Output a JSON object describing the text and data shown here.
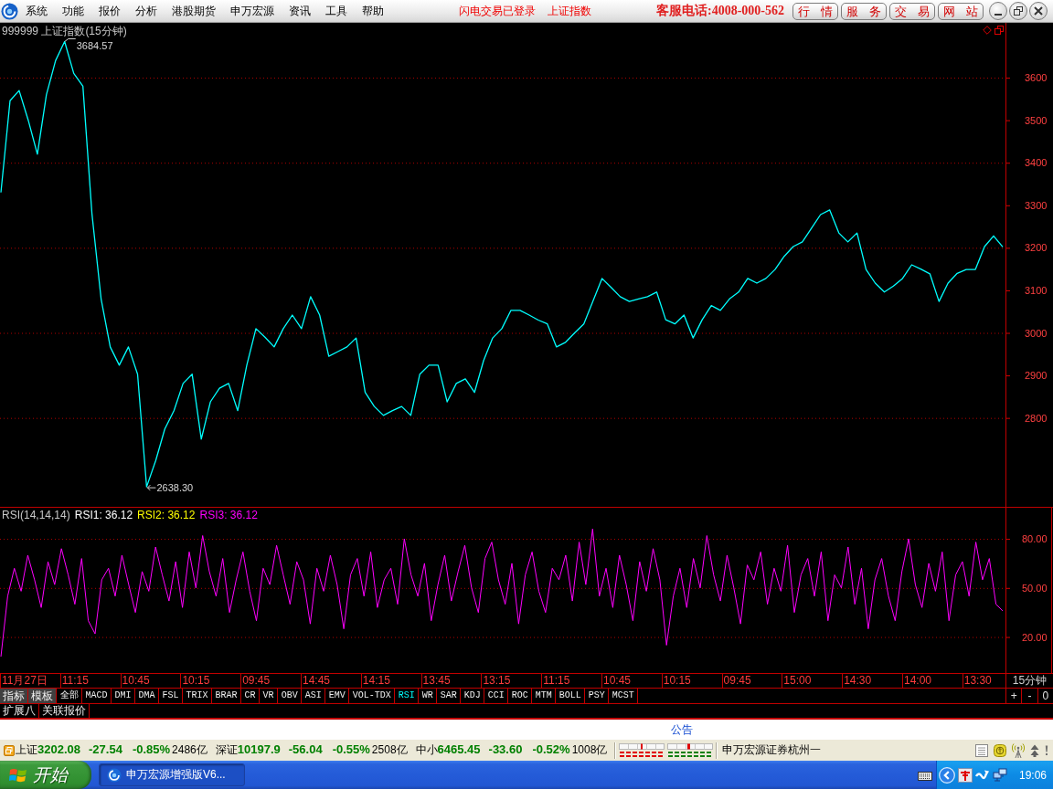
{
  "menu_bar": {
    "items": [
      "系统",
      "功能",
      "报价",
      "分析",
      "港股期货",
      "申万宏源",
      "资讯",
      "工具",
      "帮助"
    ],
    "notices": [
      "闪电交易已登录",
      "上证指数"
    ],
    "hotline": "客服电话:4008-000-562",
    "buttons": [
      "行 情",
      "服 务",
      "交 易",
      "网 站"
    ]
  },
  "price_chart": {
    "title": "999999 上证指数(15分钟)",
    "chart_data": {
      "type": "line",
      "ylim": [
        2591,
        3729
      ],
      "yticks": [
        3600,
        3500,
        3400,
        3300,
        3200,
        3100,
        3000,
        2900,
        2800
      ],
      "grid": true,
      "series": [
        {
          "color": "#00ffff",
          "values": [
            3330,
            3546,
            3570,
            3500,
            3420,
            3560,
            3640,
            3685,
            3610,
            3580,
            3280,
            3080,
            2967,
            2924,
            2967,
            2903,
            2638,
            2700,
            2774,
            2817,
            2881,
            2903,
            2750,
            2838,
            2870,
            2881,
            2817,
            2924,
            3010,
            2990,
            2967,
            3010,
            3042,
            3010,
            3085,
            3042,
            2945,
            2956,
            2967,
            2988,
            2860,
            2827,
            2806,
            2817,
            2827,
            2806,
            2903,
            2924,
            2924,
            2838,
            2881,
            2892,
            2860,
            2935,
            2988,
            3010,
            3053,
            3053,
            3042,
            3030,
            3021,
            2967,
            2978,
            3000,
            3021,
            3074,
            3128,
            3107,
            3085,
            3074,
            3080,
            3085,
            3096,
            3031,
            3021,
            3042,
            2988,
            3031,
            3064,
            3053,
            3080,
            3096,
            3128,
            3117,
            3128,
            3149,
            3180,
            3203,
            3214,
            3246,
            3278,
            3289,
            3235,
            3214,
            3235,
            3149,
            3117,
            3096,
            3110,
            3128,
            3160,
            3150,
            3139,
            3074,
            3117,
            3140,
            3149,
            3149,
            3203,
            3228,
            3202
          ]
        }
      ],
      "annotations": [
        "3684.57",
        "2638.30"
      ]
    }
  },
  "indicator_chart": {
    "name": "RSI(14,14,14)",
    "readings": [
      {
        "label": "RSI1: 36.12",
        "color": "#ffffff"
      },
      {
        "label": "RSI2: 36.12",
        "color": "#ffff00"
      },
      {
        "label": "RSI3: 36.12",
        "color": "#ff00ff"
      }
    ],
    "chart_data": {
      "type": "line",
      "ylim": [
        -2,
        99
      ],
      "yticks": [
        {
          "value": 80,
          "label": "80.00"
        },
        {
          "value": 50,
          "label": "50.00"
        },
        {
          "value": 20,
          "label": "20.00"
        }
      ],
      "grid": true,
      "series": [
        {
          "color": "#ff00ff",
          "values": [
            8,
            45,
            62,
            48,
            70,
            55,
            38,
            66,
            52,
            74,
            58,
            40,
            68,
            30,
            22,
            55,
            62,
            45,
            70,
            52,
            35,
            60,
            48,
            75,
            58,
            42,
            66,
            38,
            72,
            50,
            82,
            60,
            45,
            68,
            35,
            55,
            72,
            48,
            30,
            62,
            52,
            76,
            58,
            40,
            66,
            55,
            28,
            62,
            48,
            70,
            52,
            25,
            58,
            68,
            45,
            72,
            38,
            55,
            62,
            40,
            80,
            58,
            45,
            65,
            30,
            52,
            70,
            42,
            60,
            76,
            50,
            35,
            68,
            78,
            55,
            40,
            65,
            28,
            58,
            72,
            48,
            35,
            62,
            55,
            70,
            42,
            78,
            52,
            86,
            45,
            62,
            38,
            70,
            52,
            30,
            66,
            48,
            74,
            55,
            15,
            45,
            62,
            38,
            68,
            50,
            82,
            58,
            42,
            70,
            50,
            28,
            64,
            55,
            72,
            40,
            62,
            48,
            76,
            35,
            58,
            68,
            45,
            72,
            30,
            58,
            50,
            75,
            40,
            62,
            25,
            55,
            68,
            45,
            30,
            60,
            80,
            52,
            38,
            65,
            48,
            72,
            30,
            58,
            66,
            45,
            78,
            55,
            68,
            40,
            36
          ]
        }
      ]
    }
  },
  "time_axis": {
    "labels": [
      "11月27日",
      "11:15",
      "10:45",
      "10:15",
      "09:45",
      "14:45",
      "14:15",
      "13:45",
      "13:15",
      "11:15",
      "10:45",
      "10:15",
      "09:45",
      "15:00",
      "14:30",
      "14:00",
      "13:30"
    ],
    "period": "15分钟"
  },
  "indicator_tabs": [
    {
      "label": "指标",
      "kind": "menu",
      "selected": false
    },
    {
      "label": "模板",
      "kind": "menu",
      "selected": false
    },
    {
      "label": "全部",
      "kind": "indicator",
      "selected": false
    },
    {
      "label": "MACD",
      "kind": "indicator",
      "selected": false
    },
    {
      "label": "DMI",
      "kind": "indicator",
      "selected": false
    },
    {
      "label": "DMA",
      "kind": "indicator",
      "selected": false
    },
    {
      "label": "FSL",
      "kind": "indicator",
      "selected": false
    },
    {
      "label": "TRIX",
      "kind": "indicator",
      "selected": false
    },
    {
      "label": "BRAR",
      "kind": "indicator",
      "selected": false
    },
    {
      "label": "CR",
      "kind": "indicator",
      "selected": false
    },
    {
      "label": "VR",
      "kind": "indicator",
      "selected": false
    },
    {
      "label": "OBV",
      "kind": "indicator",
      "selected": false
    },
    {
      "label": "ASI",
      "kind": "indicator",
      "selected": false
    },
    {
      "label": "EMV",
      "kind": "indicator",
      "selected": false
    },
    {
      "label": "VOL-TDX",
      "kind": "indicator",
      "selected": false
    },
    {
      "label": "RSI",
      "kind": "indicator",
      "selected": true
    },
    {
      "label": "WR",
      "kind": "indicator",
      "selected": false
    },
    {
      "label": "SAR",
      "kind": "indicator",
      "selected": false
    },
    {
      "label": "KDJ",
      "kind": "indicator",
      "selected": false
    },
    {
      "label": "CCI",
      "kind": "indicator",
      "selected": false
    },
    {
      "label": "ROC",
      "kind": "indicator",
      "selected": false
    },
    {
      "label": "MTM",
      "kind": "indicator",
      "selected": false
    },
    {
      "label": "BOLL",
      "kind": "indicator",
      "selected": false
    },
    {
      "label": "PSY",
      "kind": "indicator",
      "selected": false
    },
    {
      "label": "MCST",
      "kind": "indicator",
      "selected": false
    }
  ],
  "zoom_buttons": [
    "+",
    "-",
    "0"
  ],
  "bottom_tabs": [
    "扩展八",
    "关联报价"
  ],
  "notice_bar": {
    "title": "公告"
  },
  "status_bar": {
    "indices": [
      {
        "name": "上证",
        "value": "3202.08",
        "change": "-27.54",
        "percent": "-0.85%",
        "volume": "2486亿"
      },
      {
        "name": "深证",
        "value": "10197.9",
        "change": "-56.04",
        "percent": "-0.55%",
        "volume": "2508亿"
      },
      {
        "name": "中小",
        "value": "6465.45",
        "change": "-33.60",
        "percent": "-0.52%",
        "volume": "1008亿"
      }
    ],
    "broker": "申万宏源证券杭州一"
  },
  "taskbar": {
    "start": "开始",
    "tasks": [
      {
        "label": "申万宏源增强版V6...",
        "selected": true
      }
    ],
    "clock": "19:06"
  }
}
